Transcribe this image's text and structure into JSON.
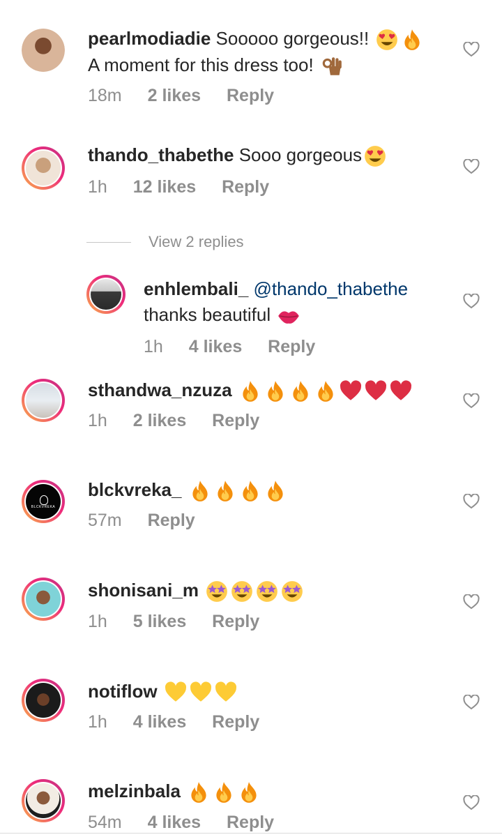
{
  "comments": [
    {
      "username": "pearlmodiadie",
      "text": "Sooooo gorgeous!!",
      "text_line2": "A moment for this dress too!",
      "time": "18m",
      "likes": "2 likes",
      "reply": "Reply"
    },
    {
      "username": "thando_thabethe",
      "text": "Sooo gorgeous",
      "time": "1h",
      "likes": "12 likes",
      "reply": "Reply"
    },
    {
      "username": "sthandwa_nzuza",
      "text": "",
      "time": "1h",
      "likes": "2 likes",
      "reply": "Reply"
    },
    {
      "username": "blckvreka_",
      "text": "",
      "time": "57m",
      "reply": "Reply",
      "avatar_text": "BLCKVREKA"
    },
    {
      "username": "shonisani_m",
      "text": "",
      "time": "1h",
      "likes": "5 likes",
      "reply": "Reply"
    },
    {
      "username": "notiflow",
      "text": "",
      "time": "1h",
      "likes": "4 likes",
      "reply": "Reply"
    },
    {
      "username": "melzinbala",
      "text": "",
      "time": "54m",
      "likes": "4 likes",
      "reply": "Reply"
    }
  ],
  "view_replies": "View 2 replies",
  "reply": {
    "username": "enhlembali_",
    "mention": "@thando_thabethe",
    "text": "thanks beautiful",
    "time": "1h",
    "likes": "4 likes",
    "reply": "Reply"
  },
  "icons": {
    "like": "heart-outline-icon"
  },
  "colors": {
    "ring_start": "#f9b24a",
    "ring_end": "#c13584",
    "meta": "#8e8e8e",
    "mention": "#00376b"
  }
}
